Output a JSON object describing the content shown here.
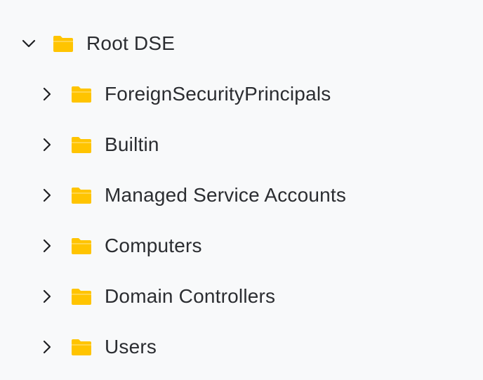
{
  "colors": {
    "background": "#F8F9FA",
    "folder": "#FFC400",
    "folder_fold": "#FFD54A",
    "text": "#2B2D31",
    "chevron": "#1F2023"
  },
  "tree": {
    "root": {
      "label": "Root DSE",
      "expanded": true,
      "icon": "folder-icon",
      "chevron_icon": "chevron-down-icon"
    },
    "children": [
      {
        "label": "ForeignSecurityPrincipals",
        "expanded": false,
        "icon": "folder-icon",
        "chevron_icon": "chevron-right-icon"
      },
      {
        "label": "Builtin",
        "expanded": false,
        "icon": "folder-icon",
        "chevron_icon": "chevron-right-icon"
      },
      {
        "label": "Managed Service Accounts",
        "expanded": false,
        "icon": "folder-icon",
        "chevron_icon": "chevron-right-icon"
      },
      {
        "label": "Computers",
        "expanded": false,
        "icon": "folder-icon",
        "chevron_icon": "chevron-right-icon"
      },
      {
        "label": "Domain Controllers",
        "expanded": false,
        "icon": "folder-icon",
        "chevron_icon": "chevron-right-icon"
      },
      {
        "label": "Users",
        "expanded": false,
        "icon": "folder-icon",
        "chevron_icon": "chevron-right-icon"
      }
    ]
  }
}
